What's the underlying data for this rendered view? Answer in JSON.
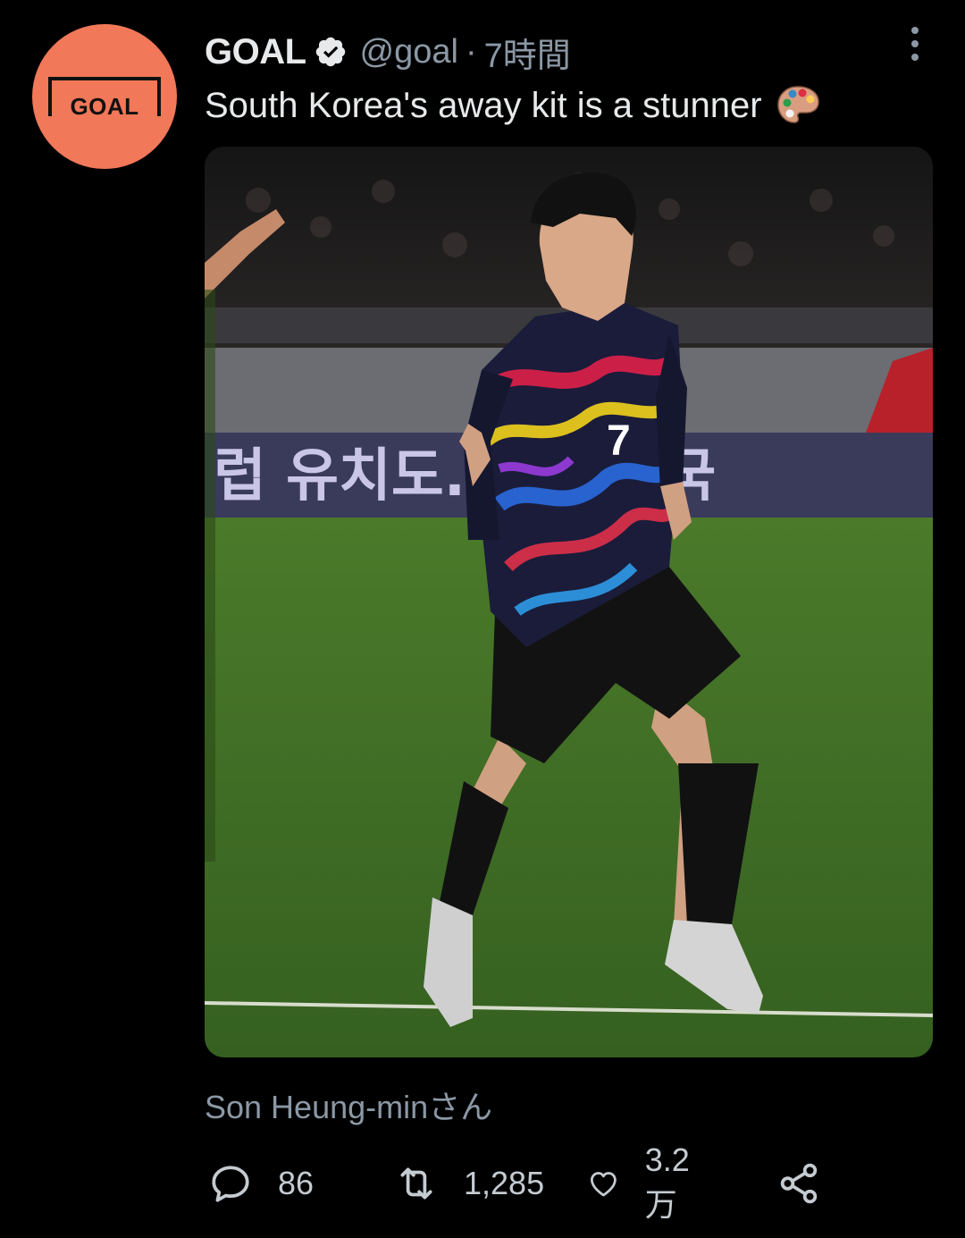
{
  "tweet": {
    "display_name": "GOAL",
    "handle": "@goal",
    "separator": "·",
    "time": "7時間",
    "text": "South Korea's away kit is a stunner",
    "emoji": "artist-palette",
    "avatar_logo_text": "GOAL",
    "tagged": "Son Heung-minさん",
    "media": {
      "description_icon": "photo",
      "banner_text": "럽 유치도. 우 한민국",
      "jersey_number": "7"
    }
  },
  "actions": {
    "replies": "86",
    "retweets": "1,285",
    "likes": "3.2万"
  },
  "colors": {
    "background": "#000000",
    "avatar_bg": "#f17858",
    "secondary_text": "#8b98a5",
    "primary_text": "#e7e9ea",
    "pitch": "#3e6a24"
  }
}
